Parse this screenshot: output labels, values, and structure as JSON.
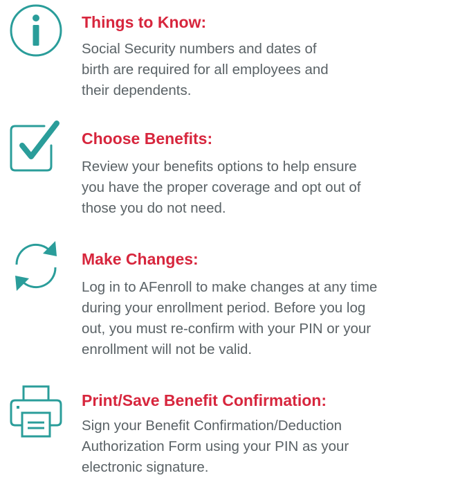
{
  "colors": {
    "heading": "#d7263d",
    "text": "#5a6266",
    "icon": "#2a9d9a"
  },
  "items": [
    {
      "icon": "info-icon",
      "title": "Things to Know:",
      "lines": [
        "Social Security numbers and dates of",
        "birth are required for all employees and",
        "their dependents."
      ]
    },
    {
      "icon": "checkbox-icon",
      "title": "Choose Benefits:",
      "lines": [
        "Review your benefits options to help ensure",
        "you have the proper coverage and opt out of",
        "those you do not need."
      ]
    },
    {
      "icon": "refresh-icon",
      "title": "Make Changes:",
      "lines": [
        "Log in to AFenroll to make changes at any time",
        "during your enrollment period. Before you log",
        "out, you must re-confirm with your PIN or your",
        "enrollment will not be valid."
      ]
    },
    {
      "icon": "printer-icon",
      "title": "Print/Save Benefit Confirmation:",
      "lines": [
        "Sign your Benefit Confirmation/Deduction",
        "Authorization Form using your PIN as your",
        "electronic signature."
      ]
    }
  ]
}
